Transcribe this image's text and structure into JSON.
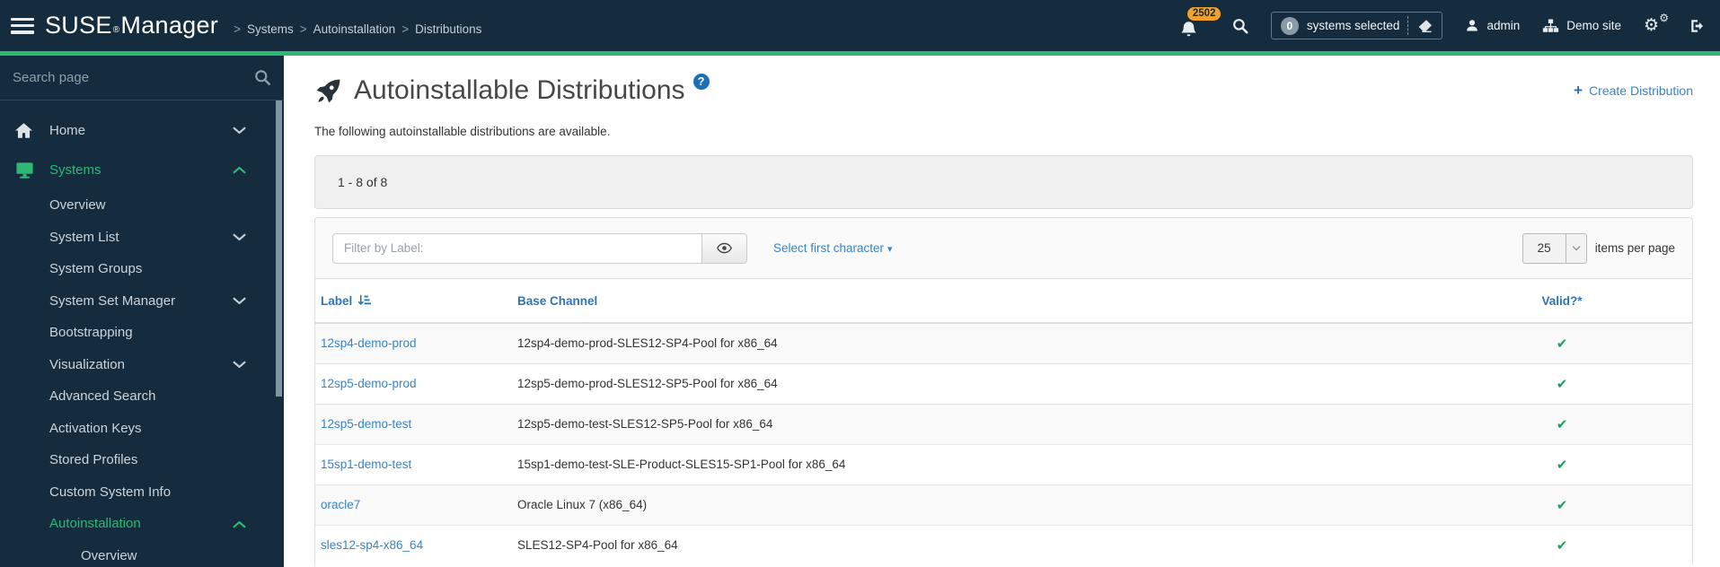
{
  "header": {
    "logo": {
      "brand": "SUSE",
      "reg": "®",
      "product": "Manager"
    },
    "breadcrumb": {
      "separator": ">",
      "items": [
        "Systems",
        "Autoinstallation",
        "Distributions"
      ]
    },
    "notification_count": "2502",
    "selection": {
      "count": "0",
      "label": "systems selected"
    },
    "user": "admin",
    "organization": "Demo site"
  },
  "sidebar": {
    "search_placeholder": "Search page",
    "items": [
      {
        "label": "Home",
        "level": 1,
        "icon": "home",
        "chevron": "down",
        "active": false
      },
      {
        "label": "Systems",
        "level": 1,
        "icon": "desktop",
        "chevron": "up",
        "active": true
      },
      {
        "label": "Overview",
        "level": 2,
        "icon": "",
        "chevron": "",
        "active": false
      },
      {
        "label": "System List",
        "level": 2,
        "icon": "",
        "chevron": "down",
        "active": false
      },
      {
        "label": "System Groups",
        "level": 2,
        "icon": "",
        "chevron": "",
        "active": false
      },
      {
        "label": "System Set Manager",
        "level": 2,
        "icon": "",
        "chevron": "down",
        "active": false
      },
      {
        "label": "Bootstrapping",
        "level": 2,
        "icon": "",
        "chevron": "",
        "active": false
      },
      {
        "label": "Visualization",
        "level": 2,
        "icon": "",
        "chevron": "down",
        "active": false
      },
      {
        "label": "Advanced Search",
        "level": 2,
        "icon": "",
        "chevron": "",
        "active": false
      },
      {
        "label": "Activation Keys",
        "level": 2,
        "icon": "",
        "chevron": "",
        "active": false
      },
      {
        "label": "Stored Profiles",
        "level": 2,
        "icon": "",
        "chevron": "",
        "active": false
      },
      {
        "label": "Custom System Info",
        "level": 2,
        "icon": "",
        "chevron": "",
        "active": false
      },
      {
        "label": "Autoinstallation",
        "level": 2,
        "icon": "",
        "chevron": "up",
        "active": true
      },
      {
        "label": "Overview",
        "level": 3,
        "icon": "",
        "chevron": "",
        "active": false
      }
    ]
  },
  "page": {
    "title": "Autoinstallable Distributions",
    "help_glyph": "?",
    "create_label": "Create Distribution",
    "create_plus": "+",
    "intro": "The following autoinstallable distributions are available.",
    "pagination": "1 - 8 of 8",
    "filter": {
      "placeholder": "Filter by Label:",
      "first_char_label": "Select first character",
      "caret": "▾",
      "page_size": "25",
      "items_per_page": "items per page"
    },
    "table": {
      "columns": {
        "label": "Label",
        "base_channel": "Base Channel",
        "valid": "Valid?*"
      },
      "rows": [
        {
          "label": "12sp4-demo-prod",
          "base_channel": "12sp4-demo-prod-SLES12-SP4-Pool for x86_64",
          "valid": "✔"
        },
        {
          "label": "12sp5-demo-prod",
          "base_channel": "12sp5-demo-prod-SLES12-SP5-Pool for x86_64",
          "valid": "✔"
        },
        {
          "label": "12sp5-demo-test",
          "base_channel": "12sp5-demo-test-SLES12-SP5-Pool for x86_64",
          "valid": "✔"
        },
        {
          "label": "15sp1-demo-test",
          "base_channel": "15sp1-demo-test-SLE-Product-SLES15-SP1-Pool for x86_64",
          "valid": "✔"
        },
        {
          "label": "oracle7",
          "base_channel": "Oracle Linux 7 (x86_64)",
          "valid": "✔"
        },
        {
          "label": "sles12-sp4-x86_64",
          "base_channel": "SLES12-SP4-Pool for x86_64",
          "valid": "✔"
        }
      ]
    }
  },
  "colors": {
    "header_bg": "#142c3e",
    "accent_green": "#2db873",
    "badge_orange": "#f0a22e",
    "link_blue": "#3a84c4",
    "table_header_blue": "#2e75b5",
    "check_green": "#1ca05c",
    "help_blue": "#1d6fb8"
  }
}
